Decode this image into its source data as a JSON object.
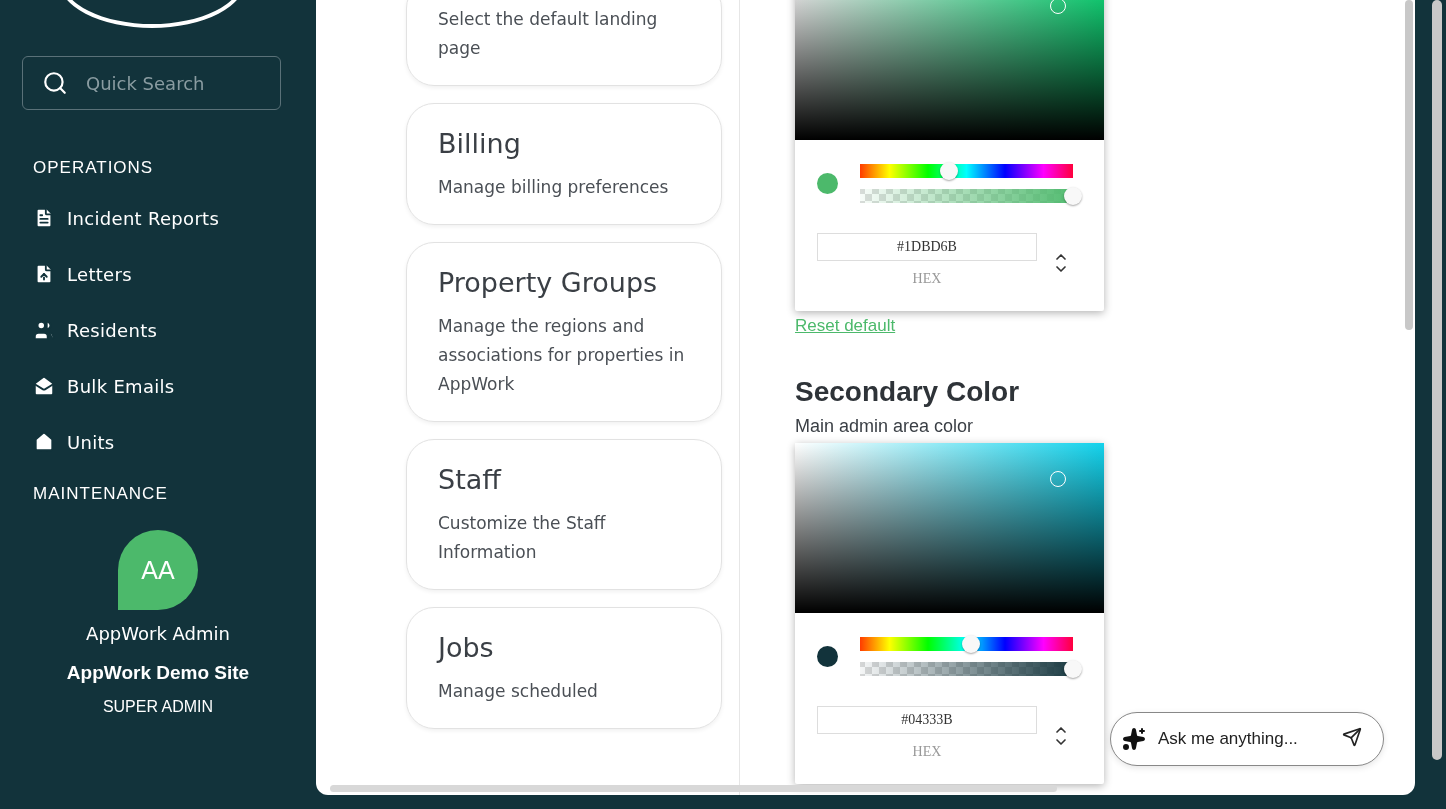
{
  "sidebar": {
    "search": {
      "placeholder": "Quick Search"
    },
    "sections": [
      {
        "title": "OPERATIONS",
        "items": [
          {
            "label": "Incident Reports"
          },
          {
            "label": "Letters"
          },
          {
            "label": "Residents"
          },
          {
            "label": "Bulk Emails"
          },
          {
            "label": "Units"
          }
        ]
      },
      {
        "title": "MAINTENANCE"
      }
    ],
    "user": {
      "initials": "AA",
      "name": "AppWork Admin",
      "site": "AppWork Demo Site",
      "role": "SUPER ADMIN"
    }
  },
  "settings_cards": [
    {
      "description": "Select the default landing page"
    },
    {
      "title": "Billing",
      "description": "Manage billing preferences"
    },
    {
      "title": "Property Groups",
      "description": "Manage the regions and associations for properties in AppWork"
    },
    {
      "title": "Staff",
      "description": "Customize the Staff Information"
    },
    {
      "title": "Jobs",
      "description": "Manage scheduled"
    }
  ],
  "color_settings": [
    {
      "hex": "#1DBD6B",
      "format": "HEX",
      "color": "#4cb96b",
      "hue": {
        "level": 0.42
      },
      "alpha": {
        "level": 1
      },
      "reset_link": "Reset default"
    },
    {
      "title": "Secondary Color",
      "subtitle": "Main admin area color",
      "hex": "#04333B",
      "format": "HEX",
      "color": "#12333b",
      "hue": {
        "level": 0.52
      },
      "alpha": {
        "level": 1
      }
    }
  ],
  "assistant": {
    "placeholder": "Ask me anything..."
  }
}
